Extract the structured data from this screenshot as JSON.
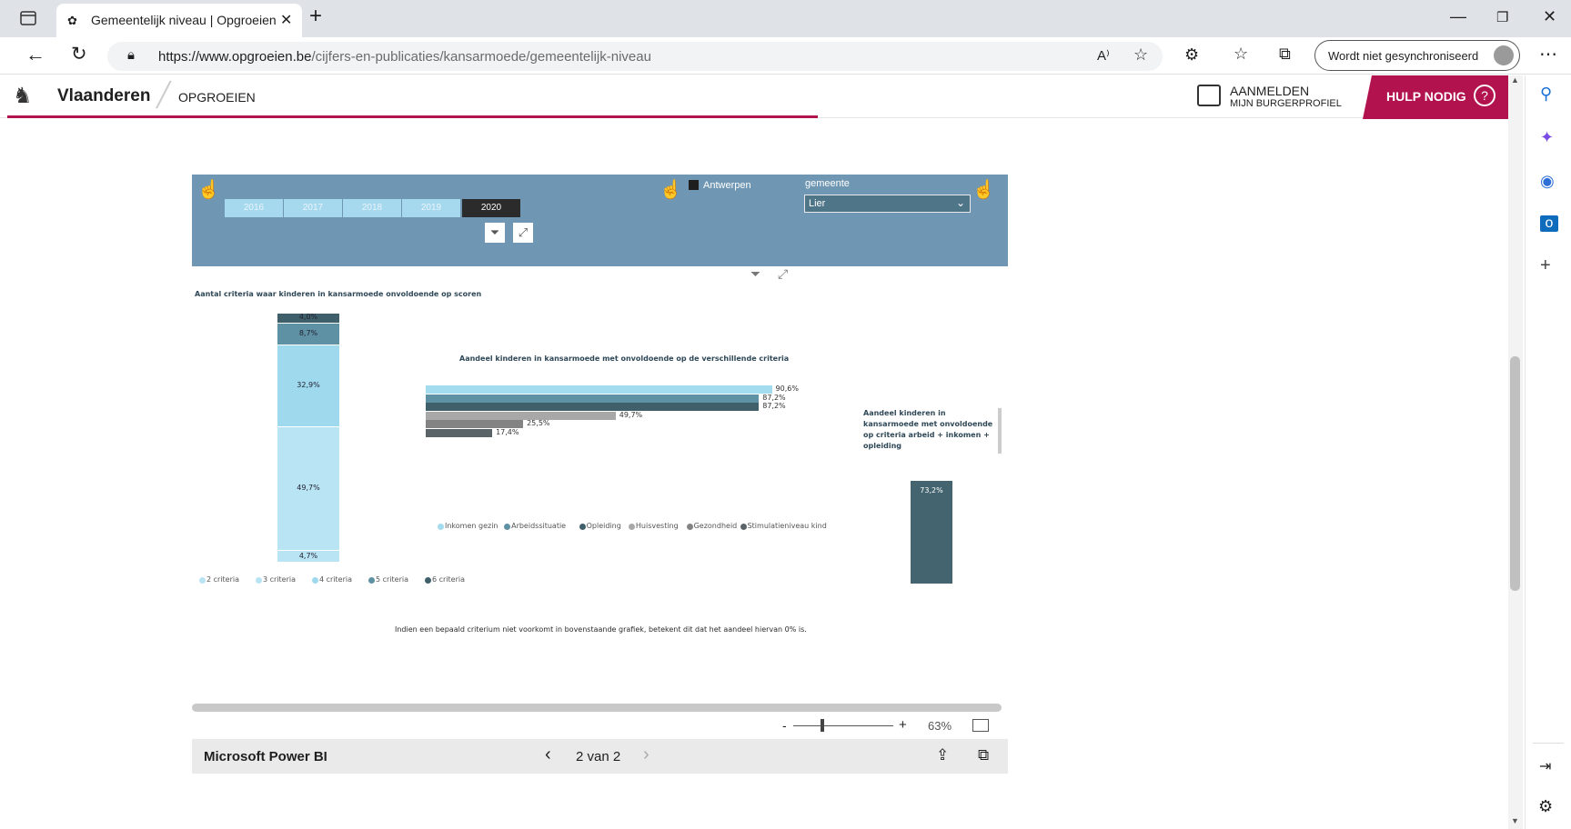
{
  "browser": {
    "tab_title": "Gemeentelijk niveau | Opgroeien",
    "url_host": "https://www.opgroeien.be",
    "url_path": "/cijfers-en-publicaties/kansarmoede/gemeentelijk-niveau",
    "sync_label": "Wordt niet gesynchroniseerd"
  },
  "site": {
    "brand": "Vlaanderen",
    "section": "OPGROEIEN",
    "login_line1": "AANMELDEN",
    "login_line2": "MIJN BURGERPROFIEL",
    "help_label": "HULP NODIG",
    "accent": "#b2124d"
  },
  "report": {
    "years": [
      "2016",
      "2017",
      "2018",
      "2019",
      "2020"
    ],
    "selected_year": "2020",
    "legend_antwerpen": "Antwerpen",
    "gemeente_label": "gemeente",
    "gemeente_value": "Lier",
    "note": "Indien een bepaald criterium niet voorkomt in bovenstaande grafiek, betekent dit dat het aandeel hiervan 0% is."
  },
  "chart_data": [
    {
      "type": "bar",
      "title": "Aantal criteria waar kinderen in kansarmoede onvoldoende op scoren",
      "stacked": true,
      "series": [
        {
          "name": "2 criteria",
          "values": [
            4.7
          ],
          "color": "#b9e4f3"
        },
        {
          "name": "3 criteria",
          "values": [
            49.7
          ],
          "color": "#b9e4f3"
        },
        {
          "name": "4 criteria",
          "values": [
            32.9
          ],
          "color": "#9fd9ee"
        },
        {
          "name": "5 criteria",
          "values": [
            8.7
          ],
          "color": "#5e91a3"
        },
        {
          "name": "6 criteria",
          "values": [
            4.0
          ],
          "color": "#3f5f6b"
        }
      ],
      "labels": [
        "4,7%",
        "49,7%",
        "32,9%",
        "8,7%",
        "4,0%"
      ]
    },
    {
      "type": "bar",
      "orientation": "horizontal",
      "title": "Aandeel kinderen in kansarmoede met onvoldoende op de verschillende criteria",
      "categories": [
        "Inkomen gezin",
        "Arbeidssituatie",
        "Opleiding",
        "Huisvesting",
        "Gezondheid",
        "Stimulatieniveau kind"
      ],
      "values": [
        90.6,
        87.2,
        87.2,
        49.7,
        25.5,
        17.4
      ],
      "labels": [
        "90,6%",
        "87,2%",
        "87,2%",
        "49,7%",
        "25,5%",
        "17,4%"
      ],
      "colors": [
        "#a3dcef",
        "#5e91a3",
        "#3f5f6b",
        "#a8a8a8",
        "#838383",
        "#5a6468"
      ],
      "xlim": [
        0,
        100
      ]
    },
    {
      "type": "bar",
      "title": "Aandeel kinderen in kansarmoede met onvoldoende op criteria arbeid + inkomen + opleiding",
      "values": [
        73.2
      ],
      "labels": [
        "73,2%"
      ],
      "color": "#44646f"
    }
  ],
  "powerbi": {
    "brand": "Microsoft Power BI",
    "page": "2 van 2",
    "zoom": "63%",
    "zoom_minus": "-",
    "zoom_plus": "+"
  }
}
